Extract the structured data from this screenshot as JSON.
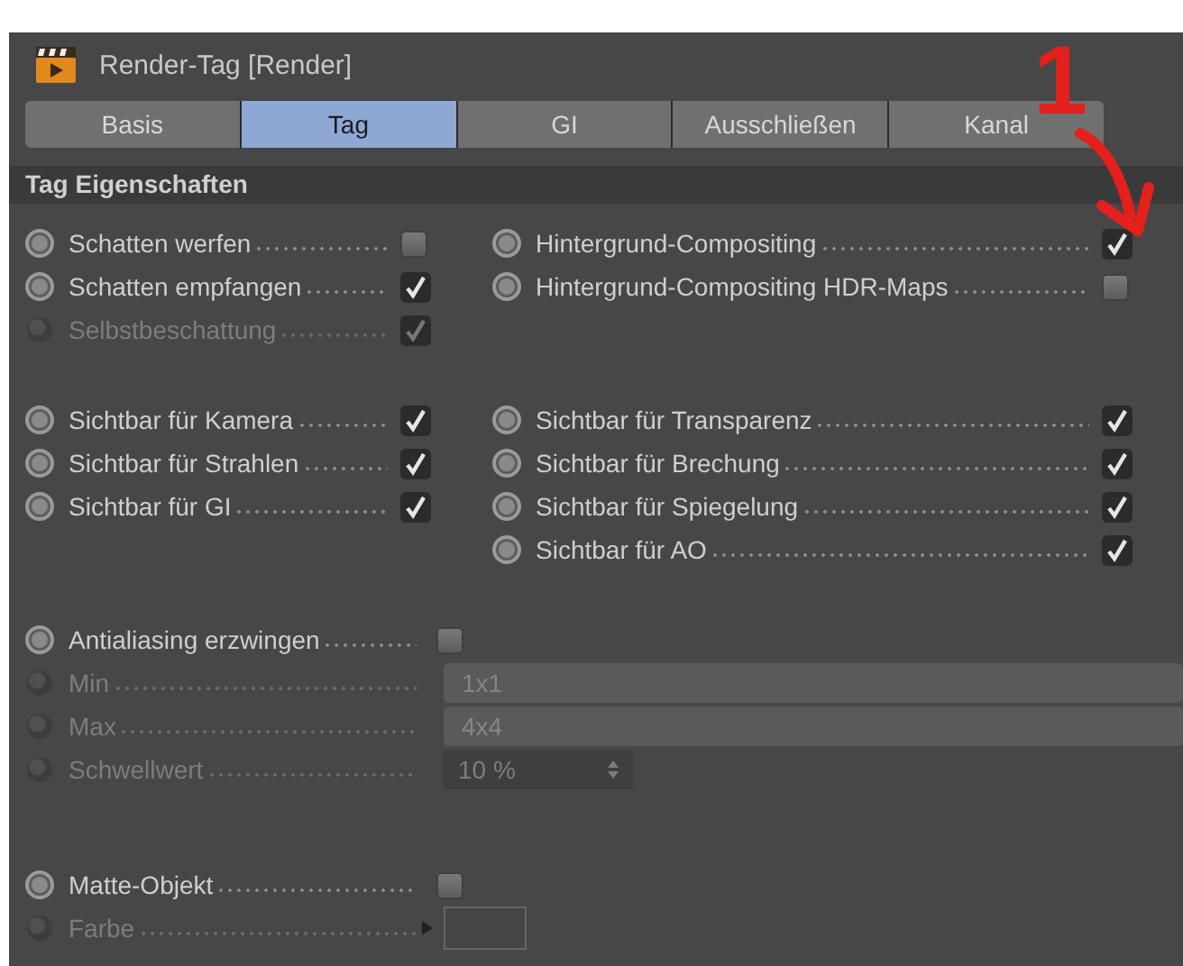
{
  "window": {
    "title": "Render-Tag [Render]"
  },
  "tabs": [
    {
      "label": "Basis",
      "selected": false
    },
    {
      "label": "Tag",
      "selected": true
    },
    {
      "label": "GI",
      "selected": false
    },
    {
      "label": "Ausschließen",
      "selected": false
    },
    {
      "label": "Kanal",
      "selected": false
    }
  ],
  "section": {
    "title": "Tag Eigenschaften"
  },
  "groups": [
    {
      "rows": [
        {
          "left": {
            "label": "Schatten werfen",
            "kind": "checkbox",
            "checked": false,
            "disabled": false
          },
          "right": {
            "label": "Hintergrund-Compositing",
            "kind": "checkbox",
            "checked": true,
            "disabled": false
          }
        },
        {
          "left": {
            "label": "Schatten empfangen",
            "kind": "checkbox",
            "checked": true,
            "disabled": false
          },
          "right": {
            "label": "Hintergrund-Compositing HDR-Maps",
            "kind": "checkbox",
            "checked": false,
            "disabled": false
          }
        },
        {
          "left": {
            "label": "Selbstbeschattung",
            "kind": "checkbox",
            "checked": true,
            "disabled": true
          }
        }
      ]
    },
    {
      "rows": [
        {
          "left": {
            "label": "Sichtbar für Kamera",
            "kind": "checkbox",
            "checked": true,
            "disabled": false
          },
          "right": {
            "label": "Sichtbar für Transparenz",
            "kind": "checkbox",
            "checked": true,
            "disabled": false
          }
        },
        {
          "left": {
            "label": "Sichtbar für Strahlen",
            "kind": "checkbox",
            "checked": true,
            "disabled": false
          },
          "right": {
            "label": "Sichtbar für Brechung",
            "kind": "checkbox",
            "checked": true,
            "disabled": false
          }
        },
        {
          "left": {
            "label": "Sichtbar für GI",
            "kind": "checkbox",
            "checked": true,
            "disabled": false
          },
          "right": {
            "label": "Sichtbar für Spiegelung",
            "kind": "checkbox",
            "checked": true,
            "disabled": false
          }
        },
        {
          "right": {
            "label": "Sichtbar für AO",
            "kind": "checkbox",
            "checked": true,
            "disabled": false
          }
        }
      ]
    },
    {
      "rows": [
        {
          "left": {
            "label": "Antialiasing erzwingen",
            "kind": "checkbox",
            "checked": false,
            "disabled": false
          }
        },
        {
          "left": {
            "label": "Min",
            "kind": "select",
            "value": "1x1",
            "disabled": true
          }
        },
        {
          "left": {
            "label": "Max",
            "kind": "select",
            "value": "4x4",
            "disabled": true
          }
        },
        {
          "left": {
            "label": "Schwellwert",
            "kind": "number",
            "value": "10 %",
            "disabled": true
          }
        }
      ]
    },
    {
      "rows": [
        {
          "left": {
            "label": "Matte-Objekt",
            "kind": "checkbox",
            "checked": false,
            "disabled": false
          }
        },
        {
          "left": {
            "label": "Farbe",
            "kind": "color",
            "disabled": true
          }
        }
      ]
    }
  ],
  "annotation": {
    "label": "1"
  }
}
